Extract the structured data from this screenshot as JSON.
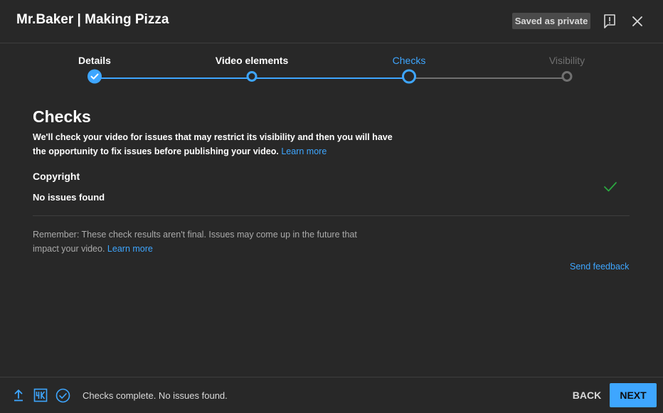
{
  "header": {
    "title": "Mr.Baker | Making Pizza",
    "saved_badge": "Saved as private",
    "feedback_icon": "report-feedback-icon",
    "close_icon": "close-icon"
  },
  "stepper": {
    "steps": [
      {
        "label": "Details",
        "state": "complete"
      },
      {
        "label": "Video elements",
        "state": "complete"
      },
      {
        "label": "Checks",
        "state": "current"
      },
      {
        "label": "Visibility",
        "state": "upcoming"
      }
    ],
    "active_color": "#3ea6ff",
    "inactive_color": "#717171"
  },
  "main": {
    "title": "Checks",
    "description": "We'll check your video for issues that may restrict its visibility and then you will have the opportunity to fix issues before publishing your video.",
    "description_link": "Learn more",
    "copyright": {
      "title": "Copyright",
      "status": "No issues found",
      "status_icon": "checkmark-icon",
      "status_color": "#2ba640"
    },
    "remember_text": "Remember: These check results aren't final. Issues may come up in the future that impact your video.",
    "remember_link": "Learn more",
    "send_feedback": "Send feedback"
  },
  "footer": {
    "icons": [
      "upload-icon",
      "hd-4k-icon",
      "checks-complete-icon"
    ],
    "status": "Checks complete. No issues found.",
    "back_label": "BACK",
    "next_label": "NEXT"
  }
}
